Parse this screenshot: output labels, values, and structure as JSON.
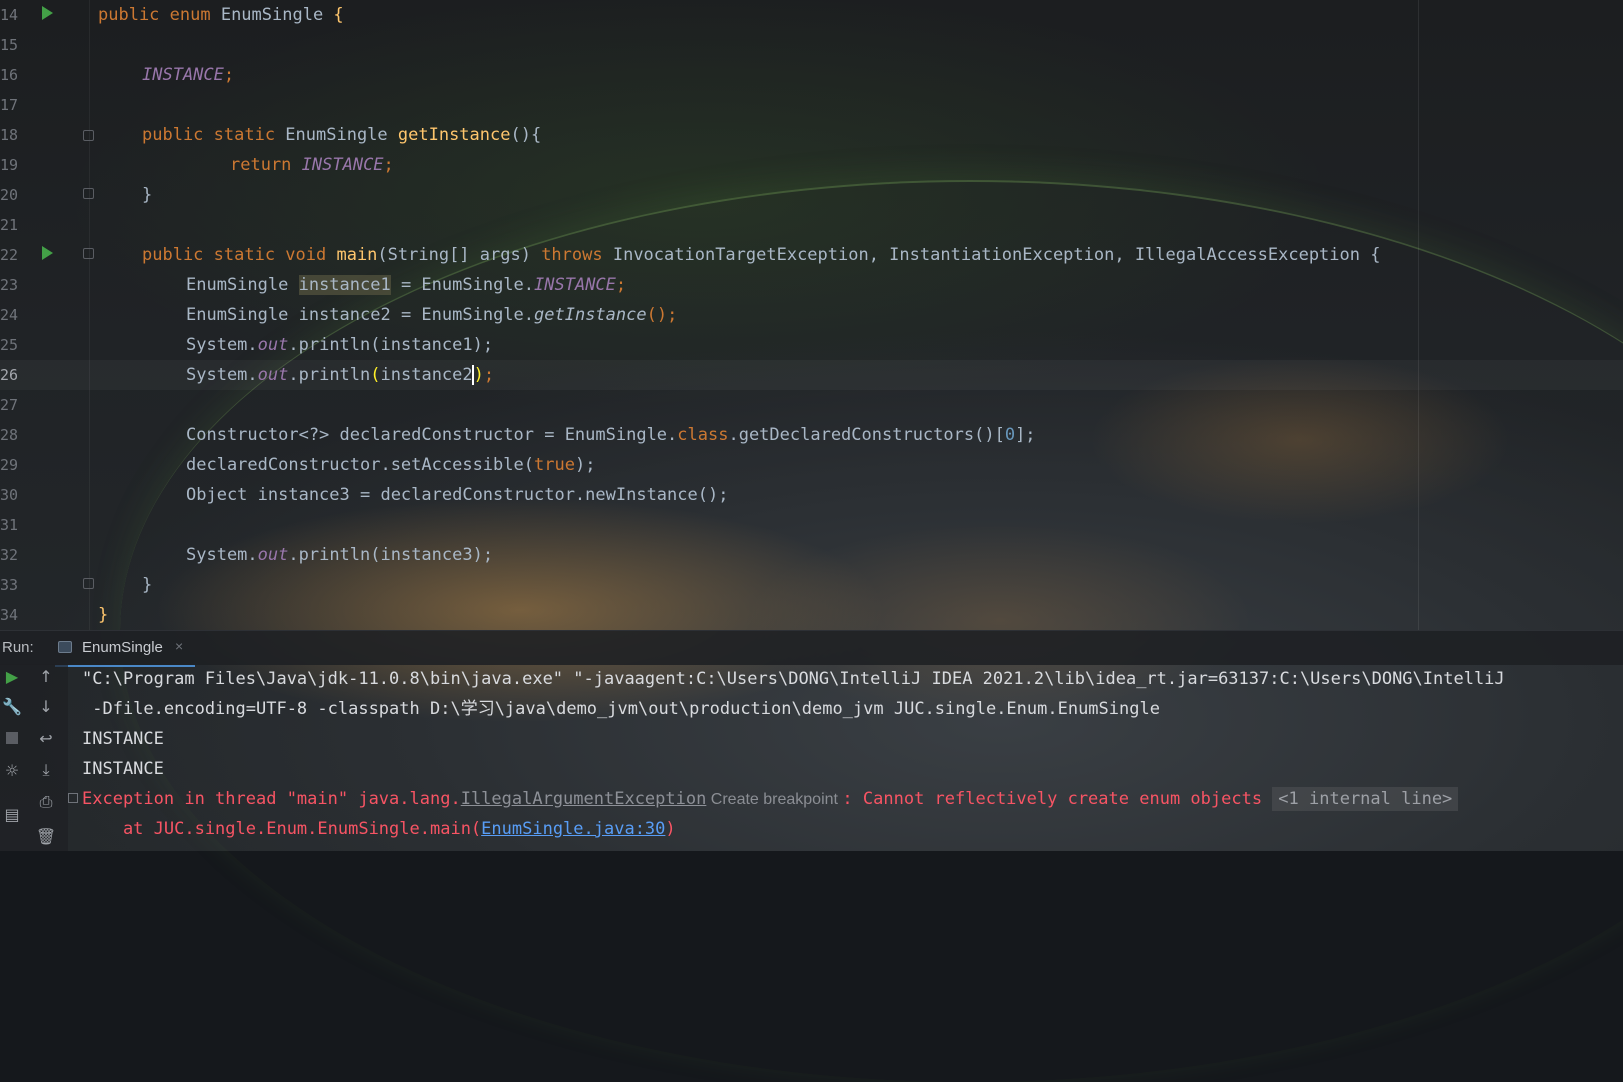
{
  "editor": {
    "lines": [
      {
        "num": "14"
      },
      {
        "num": "15"
      },
      {
        "num": "16"
      },
      {
        "num": "17"
      },
      {
        "num": "18"
      },
      {
        "num": "19"
      },
      {
        "num": "20"
      },
      {
        "num": "21"
      },
      {
        "num": "22"
      },
      {
        "num": "23"
      },
      {
        "num": "24"
      },
      {
        "num": "25"
      },
      {
        "num": "26"
      },
      {
        "num": "27"
      },
      {
        "num": "28"
      },
      {
        "num": "29"
      },
      {
        "num": "30"
      },
      {
        "num": "31"
      },
      {
        "num": "32"
      },
      {
        "num": "33"
      },
      {
        "num": "34"
      }
    ],
    "code": {
      "l14": {
        "kw": "public enum ",
        "name": "EnumSingle",
        "brace": " {"
      },
      "l16": {
        "const": "INSTANCE",
        "end": ";"
      },
      "l18": {
        "kw": "public static ",
        "type": "EnumSingle ",
        "fn": "getInstance",
        "rest": "(){"
      },
      "l19": {
        "kw": "return ",
        "const": "INSTANCE",
        "end": ";"
      },
      "l20": {
        "brace": "}"
      },
      "l22": {
        "kw": "public static void ",
        "fn": "main",
        "params": "(String[] args) ",
        "throws": "throws ",
        "exc": "InvocationTargetException, InstantiationException, IllegalAccessException",
        "brace": " {"
      },
      "l23": {
        "type": "EnumSingle ",
        "var": "instance1",
        "eq": " = EnumSingle.",
        "const": "INSTANCE",
        "end": ";"
      },
      "l24": {
        "type": "EnumSingle ",
        "var": "instance2",
        "eq": " = EnumSingle.",
        "call": "getInstance",
        "end": "();"
      },
      "l25": {
        "sys": "System.",
        "out": "out",
        "rest": ".println(instance1);"
      },
      "l26": {
        "sys": "System.",
        "out": "out",
        "p1": ".println",
        "open": "(",
        "arg": "instance2",
        "close": ")",
        "end": ";"
      },
      "l28": {
        "pre": "Constructor<?> declaredConstructor = EnumSingle.",
        "kw": "class",
        "mid": ".getDeclaredConstructors()[",
        "num": "0",
        "end": "];"
      },
      "l29": {
        "pre": "declaredConstructor.setAccessible(",
        "kw": "true",
        "end": ");"
      },
      "l30": {
        "pre": "Object instance3 = declaredConstructor.newInstance();"
      },
      "l32": {
        "sys": "System.",
        "out": "out",
        "rest": ".println(instance3);"
      },
      "l33": {
        "brace": "}"
      },
      "l34": {
        "brace": "}"
      }
    }
  },
  "run_panel": {
    "label": "Run:",
    "tab_label": "EnumSingle",
    "tab_close": "×",
    "output": {
      "cmd1": "\"C:\\Program Files\\Java\\jdk-11.0.8\\bin\\java.exe\" \"-javaagent:C:\\Users\\DONG\\IntelliJ IDEA 2021.2\\lib\\idea_rt.jar=63137:C:\\Users\\DONG\\IntelliJ",
      "cmd2": " -Dfile.encoding=UTF-8 -classpath D:\\学习\\java\\demo_jvm\\out\\production\\demo_jvm JUC.single.Enum.EnumSingle",
      "out1": "INSTANCE",
      "out2": "INSTANCE",
      "err_prefix": "Exception in thread \"main\" java.lang.",
      "err_exception": "IllegalArgumentException",
      "err_hint": " Create breakpoint ",
      "err_msg": ": Cannot reflectively create enum objects ",
      "err_internal": "<1 internal line>",
      "trace_prefix": "    at JUC.single.Enum.EnumSingle.main(",
      "trace_link": "EnumSingle.java:30",
      "trace_suffix": ")"
    }
  }
}
